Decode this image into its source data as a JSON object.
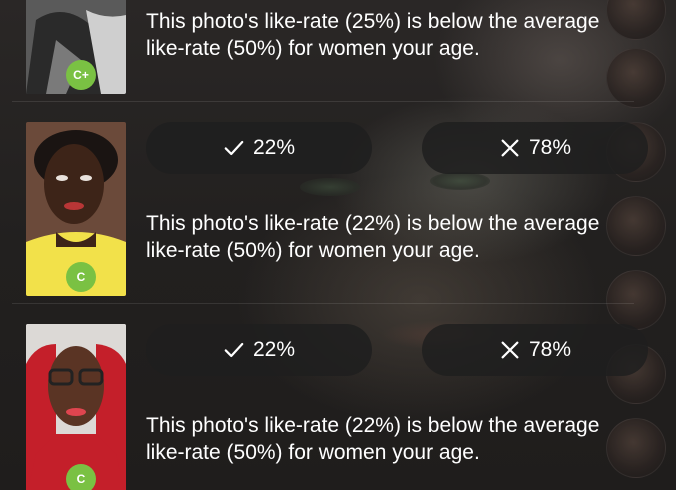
{
  "rows": [
    {
      "grade": "C+",
      "message_line1": "This photo's like-rate (25%) is below the average",
      "message_line2": "like-rate (50%) for women your age."
    },
    {
      "grade": "C",
      "like_percent": "22%",
      "dislike_percent": "78%",
      "message_line1": "This photo's like-rate (22%) is below the average",
      "message_line2": "like-rate (50%) for women your age."
    },
    {
      "grade": "C",
      "like_percent": "22%",
      "dislike_percent": "78%",
      "message_line1": "This photo's like-rate (22%) is below the average",
      "message_line2": "like-rate (50%) for women your age."
    }
  ],
  "colors": {
    "grade_badge": "#7ac143",
    "pill_background": "#1e1e1e",
    "text": "#ffffff"
  },
  "icons": {
    "like": "checkmark-icon",
    "dislike": "x-icon"
  }
}
